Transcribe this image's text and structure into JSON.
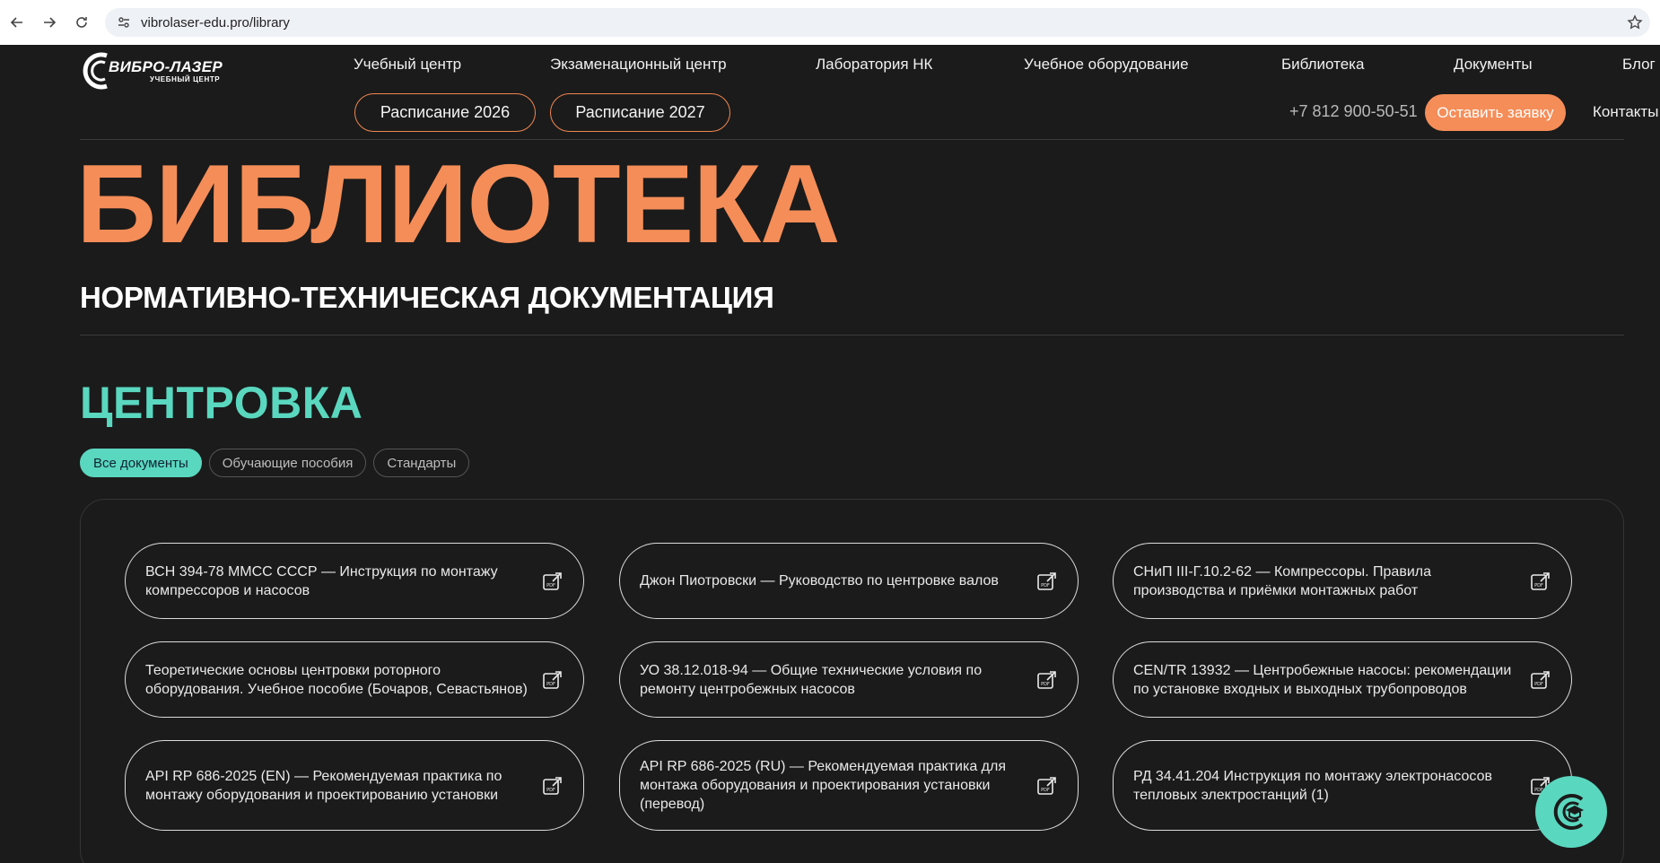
{
  "browser": {
    "url": "vibrolaser-edu.pro/library"
  },
  "logo": {
    "main": "ВИБРО-ЛАЗЕР",
    "sub": "УЧЕБНЫЙ ЦЕНТР"
  },
  "nav": {
    "items": [
      {
        "label": "Учебный центр"
      },
      {
        "label": "Экзаменационный центр"
      },
      {
        "label": "Лаборатория НК"
      },
      {
        "label": "Учебное оборудование"
      },
      {
        "label": "Библиотека"
      },
      {
        "label": "Документы"
      },
      {
        "label": "Блог"
      }
    ],
    "schedule_2026": "Расписание 2026",
    "schedule_2027": "Расписание 2027",
    "phone": "+7 812 900-50-51",
    "cta": "Оставить заявку",
    "contacts": "Контакты"
  },
  "hero": {
    "title": "БИБЛИОТЕКА",
    "subtitle": "НОРМАТИВНО-ТЕХНИЧЕСКАЯ ДОКУМЕНТАЦИЯ"
  },
  "section": {
    "title": "ЦЕНТРОВКА",
    "filters": [
      {
        "label": "Все документы",
        "active": true
      },
      {
        "label": "Обучающие пособия",
        "active": false
      },
      {
        "label": "Стандарты",
        "active": false
      }
    ]
  },
  "documents": [
    {
      "title": "ВСН 394-78 ММСС СССР — Инструкция по монтажу компрессоров и насосов"
    },
    {
      "title": "Джон Пиотровски — Руководство по центровке валов"
    },
    {
      "title": "СНиП III-Г.10.2-62 — Компрессоры. Правила производства и приёмки монтажных работ"
    },
    {
      "title": "Теоретические основы центровки роторного оборудования. Учебное пособие (Бочаров, Севастьянов)"
    },
    {
      "title": "УО 38.12.018-94 — Общие технические условия по ремонту центробежных насосов"
    },
    {
      "title": "CEN/TR 13932 — Центробежные насосы: рекомендации по установке входных и выходных трубопроводов"
    },
    {
      "title": "API RP 686-2025 (EN) — Рекомендуемая практика по монтажу оборудования и проектированию установки"
    },
    {
      "title": "API RP 686-2025 (RU) — Рекомендуемая практика для монтажа оборудования и проектирования установки (перевод)"
    },
    {
      "title": "РД 34.41.204 Инструкция по монтажу электронасосов тепловых электростанций (1)"
    }
  ],
  "colors": {
    "accent_orange": "#f58d58",
    "accent_teal": "#5ad7bf",
    "background": "#1b1b1b"
  }
}
